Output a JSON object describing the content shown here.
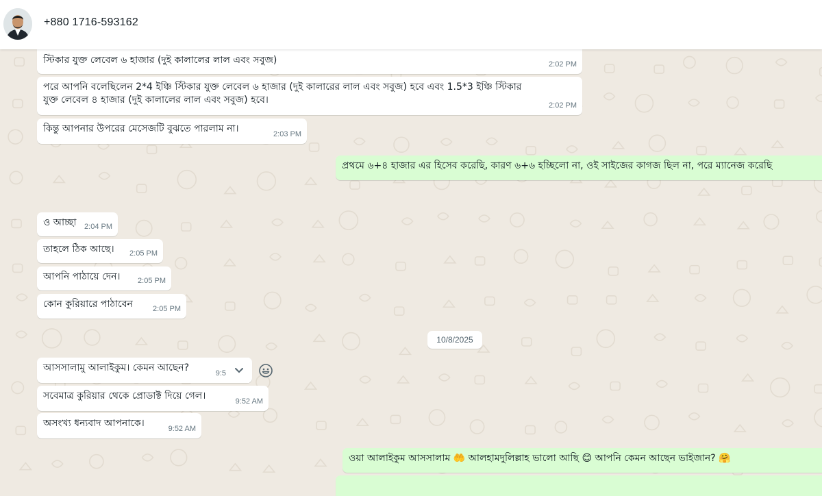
{
  "header": {
    "contact_name": "+880 1716-593162"
  },
  "messages": [
    {
      "dir": "in",
      "text": "স্টিকার যুক্ত লেবেল ৬ হাজার (দুই কালালের লাল এবং সবুজ)",
      "time": "2:02 PM"
    },
    {
      "dir": "in",
      "lines": [
        "পরে আপনি বলেছিলেন 2*4 ইঞ্চি স্টিকার যুক্ত লেবেল ৬ হাজার (দুই কালারের লাল এবং সবুজ) হবে এবং 1.5*3 ইঞ্চি স্টিকার",
        "যুক্ত লেবেল ৪ হাজার (দুই কালালের লাল এবং সবুজ) হবে।"
      ],
      "time": "2:02 PM"
    },
    {
      "dir": "in",
      "text": "কিন্তু আপনার উপরের মেসেজটি বুঝতে পারলাম না।",
      "time": "2:03 PM"
    },
    {
      "dir": "out",
      "text": "প্রথমে ৬+৪ হাজার এর হিসেব করেছি, কারণ ৬+৬ হচ্ছিলো না, ওই সাইজের কাগজ ছিল না, পরে ম্যানেজ করেছি"
    },
    {
      "dir": "in",
      "text": "ও আচ্ছা",
      "time": "2:04 PM"
    },
    {
      "dir": "in",
      "text": "তাহলে ঠিক আছে।",
      "time": "2:05 PM"
    },
    {
      "dir": "in",
      "text": "আপনি পাঠায়ে দেন।",
      "time": "2:05 PM"
    },
    {
      "dir": "in",
      "text": "কোন কুরিয়ারে পাঠাবেন",
      "time": "2:05 PM"
    },
    {
      "dir": "in",
      "text": "আসসালামু আলাইকুম। কেমন আছেন?",
      "time": "9:5"
    },
    {
      "dir": "in",
      "text": "সবেমাত্র কুরিয়ার থেকে প্রোডাক্ট দিয়ে গেল।",
      "time": "9:52 AM"
    },
    {
      "dir": "in",
      "text": "অসংখ্য ধন্যবাদ আপনাকে।",
      "time": "9:52 AM"
    },
    {
      "dir": "out",
      "text": "ওয়া আলাইকুম আসসালাম 🤲 আলহামদুলিল্লাহ ভালো আছি 😊 আপনি কেমন আছেন ভাইজান? 🤗"
    }
  ],
  "date_separator": "10/8/2025",
  "colors": {
    "incoming": "#ffffff",
    "outgoing": "#d9fdd3",
    "chat_bg": "#efeae2"
  },
  "icons": [
    "chevron-down-icon",
    "emoji-react-icon"
  ]
}
